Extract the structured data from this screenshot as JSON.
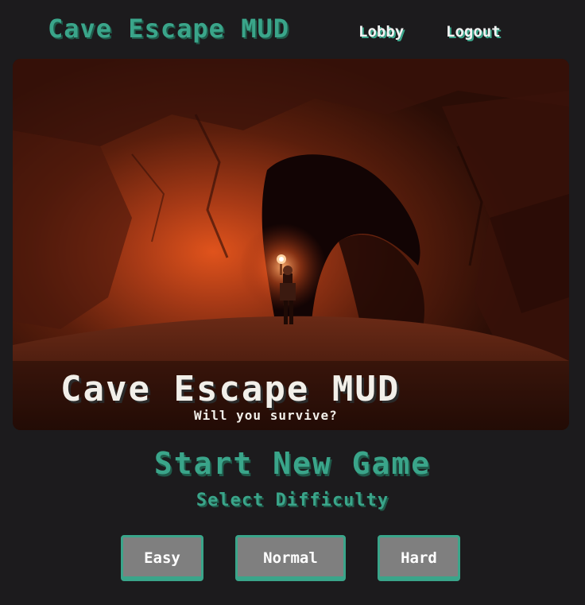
{
  "header": {
    "title": "Cave Escape MUD",
    "nav": {
      "lobby": "Lobby",
      "logout": "Logout"
    }
  },
  "hero": {
    "title": "Cave Escape MUD",
    "subtitle": "Will you survive?"
  },
  "main": {
    "heading": "Start New Game",
    "subheading": "Select Difficulty",
    "buttons": {
      "easy": "Easy",
      "normal": "Normal",
      "hard": "Hard"
    }
  },
  "colors": {
    "background": "#1c1b1d",
    "accent": "#3aa58a",
    "button": "#7f7f7f",
    "text": "#f2f2f2"
  }
}
